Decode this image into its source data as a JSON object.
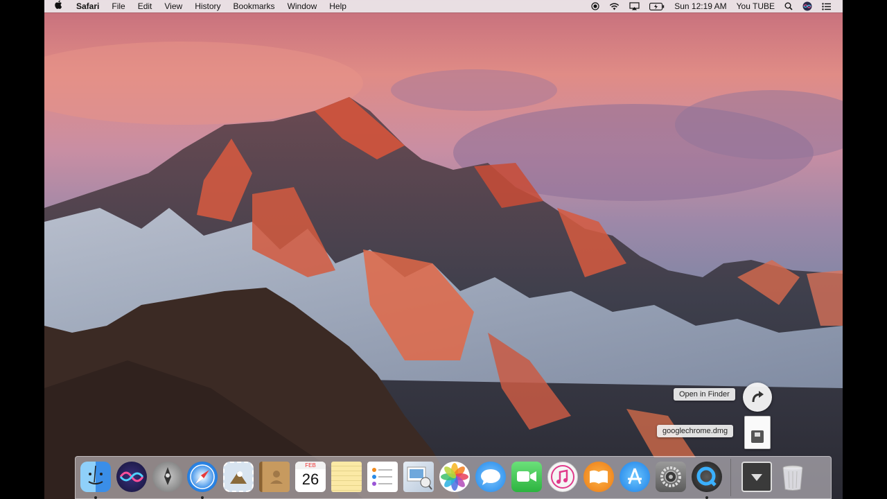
{
  "menubar": {
    "apple_glyph": "",
    "app_name": "Safari",
    "menus": [
      "File",
      "Edit",
      "View",
      "History",
      "Bookmarks",
      "Window",
      "Help"
    ],
    "clock": "Sun 12:19 AM",
    "user": "You TUBE"
  },
  "download_popover": {
    "open_label": "Open in Finder",
    "file_name": "googlechrome.dmg"
  },
  "dock": {
    "items": [
      {
        "name": "finder",
        "icon": "finder-icon",
        "color": "#3a9df0",
        "running": true
      },
      {
        "name": "siri",
        "icon": "siri-icon",
        "color": "#2a2a6a",
        "running": false
      },
      {
        "name": "launchpad",
        "icon": "launchpad-icon",
        "color": "#8a8a8a",
        "running": false
      },
      {
        "name": "safari",
        "icon": "safari-icon",
        "color": "#1e7ae0",
        "running": true
      },
      {
        "name": "mail-stamp",
        "icon": "mail-icon",
        "color": "#cfd9e6",
        "running": false
      },
      {
        "name": "contacts",
        "icon": "contacts-icon",
        "color": "#b58a55",
        "running": false
      },
      {
        "name": "calendar",
        "icon": "calendar-icon",
        "color": "#ffffff",
        "running": false
      },
      {
        "name": "notes",
        "icon": "notes-icon",
        "color": "#f6e39a",
        "running": false
      },
      {
        "name": "reminders",
        "icon": "reminders-icon",
        "color": "#fafafa",
        "running": false
      },
      {
        "name": "preview",
        "icon": "preview-icon",
        "color": "#d9e6f2",
        "running": false
      },
      {
        "name": "photos",
        "icon": "photos-icon",
        "color": "#ffffff",
        "running": false
      },
      {
        "name": "messages",
        "icon": "messages-icon",
        "color": "#2f9cf0",
        "running": false
      },
      {
        "name": "facetime",
        "icon": "facetime-icon",
        "color": "#3ac24f",
        "running": false
      },
      {
        "name": "itunes",
        "icon": "itunes-icon",
        "color": "#f2f2f2",
        "running": false
      },
      {
        "name": "ibooks",
        "icon": "ibooks-icon",
        "color": "#f08a1e",
        "running": false
      },
      {
        "name": "app-store",
        "icon": "app-store-icon",
        "color": "#1f8ef0",
        "running": false
      },
      {
        "name": "system-preferences",
        "icon": "system-preferences-icon",
        "color": "#7a7a7a",
        "running": false
      },
      {
        "name": "quicktime",
        "icon": "quicktime-icon",
        "color": "#3a3a3a",
        "running": true
      }
    ],
    "calendar_month": "FEB",
    "calendar_day": "26"
  }
}
